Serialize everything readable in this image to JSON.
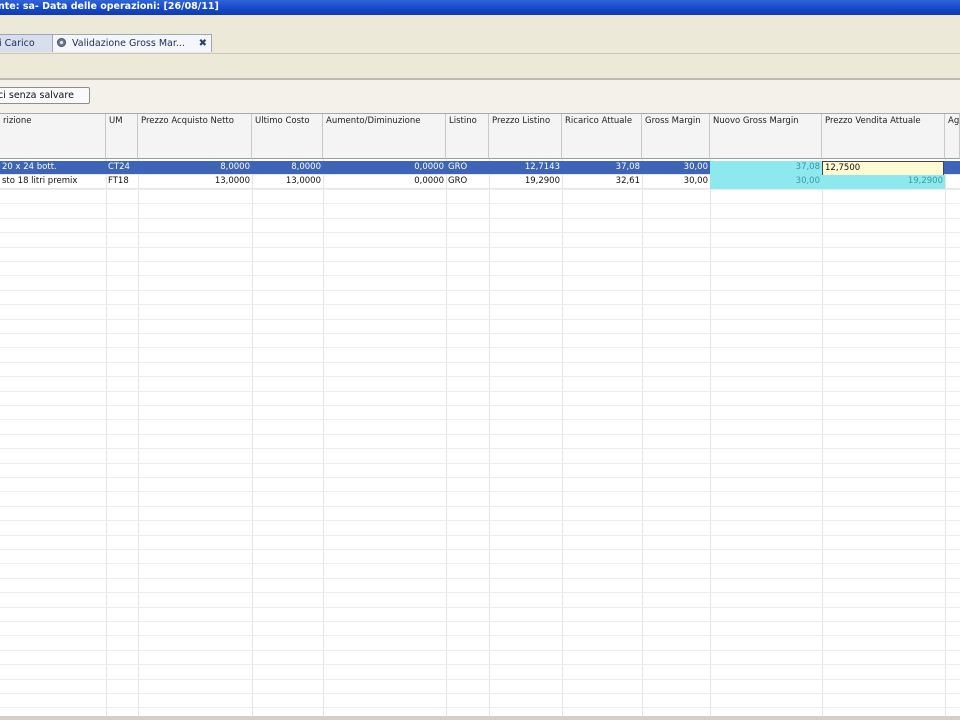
{
  "window": {
    "title": "nte: sa- Data delle operazioni: [26/08/11]"
  },
  "tabs": [
    {
      "label": "i Carico"
    },
    {
      "label": "Validazione Gross Mar...",
      "close": "✖"
    }
  ],
  "toolbar": {
    "exit_label": "ci senza salvare"
  },
  "grid": {
    "columns": [
      {
        "label": "rizione"
      },
      {
        "label": "UM"
      },
      {
        "label": "Prezzo Acquisto Netto"
      },
      {
        "label": "Ultimo Costo"
      },
      {
        "label": "Aumento/Diminuzione"
      },
      {
        "label": "Listino"
      },
      {
        "label": "Prezzo Listino"
      },
      {
        "label": "Ricarico Attuale"
      },
      {
        "label": "Gross Margin"
      },
      {
        "label": "Nuovo Gross Margin"
      },
      {
        "label": "Prezzo Vendita Attuale"
      },
      {
        "label": "Ag"
      }
    ],
    "rows": [
      {
        "selected": true,
        "cells": [
          "20 x 24 bott.",
          "CT24",
          "8,0000",
          "8,0000",
          "0,0000",
          "GRO",
          "12,7143",
          "37,08",
          "30,00",
          "37,08",
          "12,7500",
          ""
        ]
      },
      {
        "selected": false,
        "cells": [
          "sto 18 litri premix",
          "FT18",
          "13,0000",
          "13,0000",
          "0,0000",
          "GRO",
          "19,2900",
          "32,61",
          "30,00",
          "30,00",
          "19,2900",
          ""
        ]
      }
    ],
    "colors": {
      "selection": "#3d64b6",
      "editable_cell": "#8ee9ef",
      "editor_bg": "#fffbd2"
    }
  }
}
